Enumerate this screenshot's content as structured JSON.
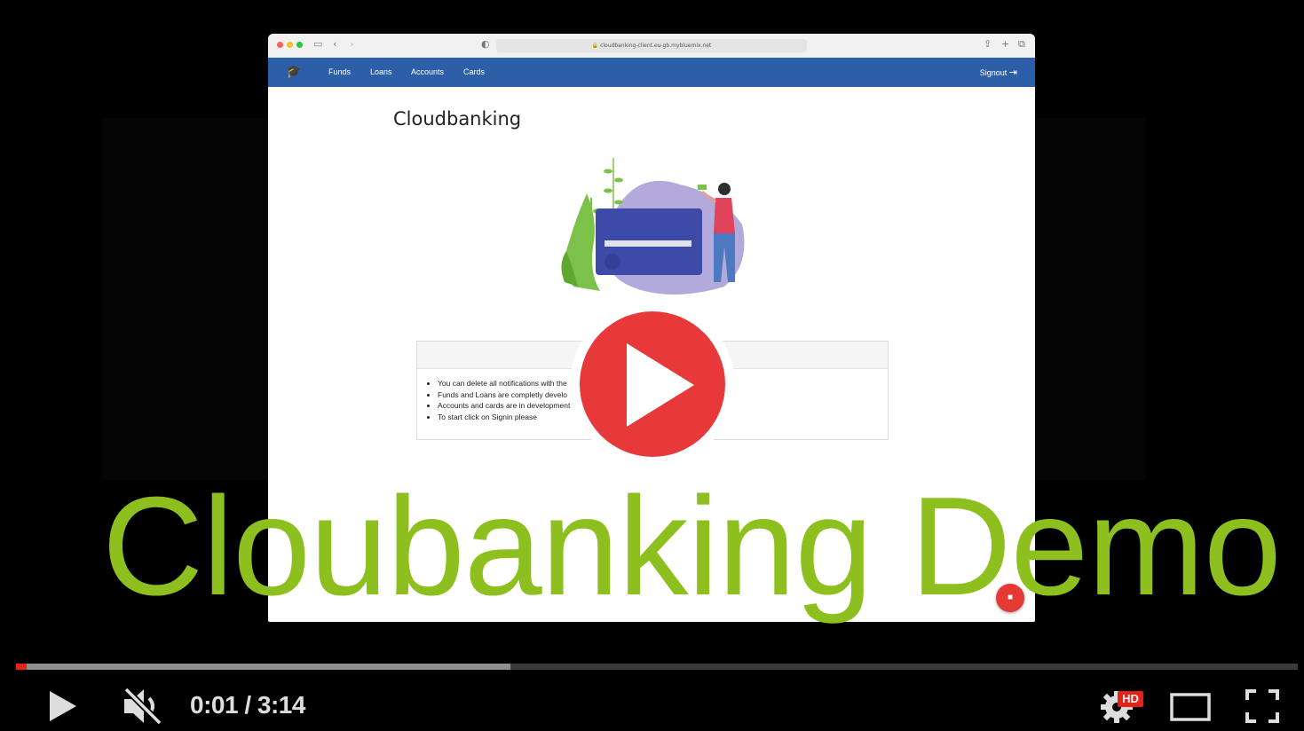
{
  "browser": {
    "url": "cloudbanking-client.eu-gb.mybluemix.net"
  },
  "nav": {
    "links": [
      "Funds",
      "Loans",
      "Accounts",
      "Cards"
    ],
    "signout": "Signout"
  },
  "page": {
    "title": "Cloudbanking",
    "notes": [
      "You can delete all notifications with the",
      "Funds and Loans are completly develo",
      "Accounts and cards are in development",
      "To start click on Signin please"
    ]
  },
  "video": {
    "overlay_title": "Cloubanking Demo",
    "time_display": "0:01 / 3:14",
    "played_fraction": 0.008,
    "buffered_fraction": 0.386,
    "hd_badge": "HD",
    "accent_color": "#e62117",
    "title_color": "#8dbf1f"
  },
  "icons": {
    "play": "play-icon",
    "mute": "muted-speaker-icon",
    "settings": "gear-icon",
    "theater": "theater-mode-icon",
    "fullscreen": "fullscreen-icon",
    "logo": "graduation-cap-icon"
  }
}
